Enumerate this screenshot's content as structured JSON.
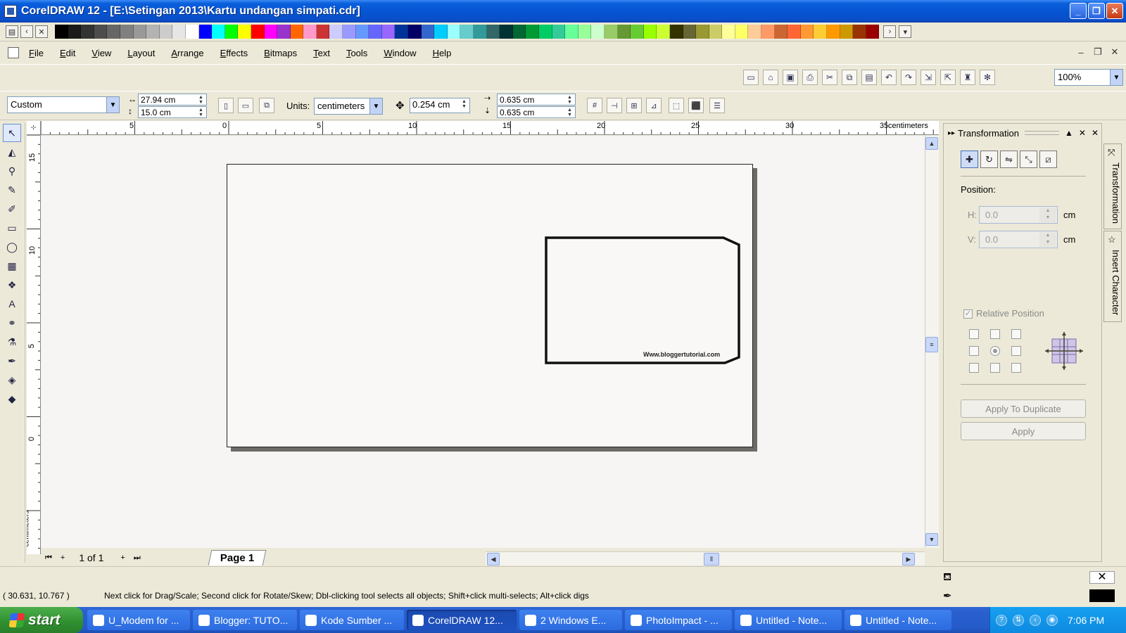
{
  "window": {
    "title": "CorelDRAW 12 - [E:\\Setingan 2013\\Kartu undangan simpati.cdr]"
  },
  "palette": {
    "colors": [
      "#000000",
      "#1a1a1a",
      "#333333",
      "#4d4d4d",
      "#666666",
      "#808080",
      "#999999",
      "#b3b3b3",
      "#cccccc",
      "#e6e6e6",
      "#ffffff",
      "#0000ff",
      "#00ffff",
      "#00ff00",
      "#ffff00",
      "#ff0000",
      "#ff00ff",
      "#9933cc",
      "#ff6600",
      "#ff99cc",
      "#cc3333",
      "#ccccff",
      "#9999ff",
      "#6699ff",
      "#6666ff",
      "#9966ff",
      "#003399",
      "#000066",
      "#3366cc",
      "#00ccff",
      "#99ffff",
      "#66cccc",
      "#339999",
      "#336666",
      "#003333",
      "#006633",
      "#009933",
      "#00cc66",
      "#33cc99",
      "#66ff99",
      "#99ff99",
      "#ccffcc",
      "#99cc66",
      "#669933",
      "#66cc33",
      "#99ff00",
      "#ccff33",
      "#333300",
      "#666633",
      "#999933",
      "#cccc66",
      "#ffff99",
      "#ffff66",
      "#ffcc99",
      "#ff9966",
      "#cc6633",
      "#ff6633",
      "#ff9933",
      "#ffcc33",
      "#ff9900",
      "#cc9900",
      "#993300",
      "#990000"
    ]
  },
  "menu": {
    "items": [
      {
        "first": "F",
        "rest": "ile"
      },
      {
        "first": "E",
        "rest": "dit"
      },
      {
        "first": "V",
        "rest": "iew"
      },
      {
        "first": "L",
        "rest": "ayout"
      },
      {
        "first": "A",
        "rest": "rrange"
      },
      {
        "first": "E",
        "rest": "ffects"
      },
      {
        "first": "B",
        "rest": "itmaps"
      },
      {
        "first": "T",
        "rest": "ext"
      },
      {
        "first": "T",
        "rest": "ools"
      },
      {
        "first": "W",
        "rest": "indow"
      },
      {
        "first": "H",
        "rest": "elp"
      }
    ]
  },
  "standard_toolbar": {
    "zoom": "100%"
  },
  "property_bar": {
    "paper_type": "Custom",
    "width": "27.94 cm",
    "height": "15.0 cm",
    "units_label": "Units:",
    "units_value": "centimeters",
    "nudge": "0.254 cm",
    "dup_x": "0.635 cm",
    "dup_y": "0.635 cm"
  },
  "ruler": {
    "h_labels": [
      "5",
      "0",
      "5",
      "10",
      "15",
      "20",
      "25",
      "30",
      "35"
    ],
    "h_unit": "centimeters",
    "v_labels": [
      "15",
      "10",
      "5",
      "0"
    ],
    "v_unit": "centimeters"
  },
  "canvas": {
    "card_url": "Www.bloggertutorial.com"
  },
  "page_nav": {
    "count": "1 of 1",
    "tab": "Page 1"
  },
  "docker": {
    "title": "Transformation",
    "position_label": "Position:",
    "h_label": "H:",
    "h_value": "0.0",
    "v_label": "V:",
    "v_value": "0.0",
    "unit": "cm",
    "relative_position": "Relative Position",
    "relative_checked": true,
    "apply_duplicate": "Apply To Duplicate",
    "apply": "Apply",
    "side_tabs": [
      "Transformation",
      "Insert Character"
    ]
  },
  "status": {
    "coords": "( 30.631, 10.767 )",
    "message": "Next click for Drag/Scale; Second click for Rotate/Skew; Dbl-clicking tool selects all objects; Shift+click multi-selects; Alt+click digs"
  },
  "taskbar": {
    "start": "start",
    "tasks": [
      {
        "label": "U_Modem for ...",
        "active": false
      },
      {
        "label": "Blogger: TUTO...",
        "active": false
      },
      {
        "label": "Kode Sumber ...",
        "active": false
      },
      {
        "label": "CorelDRAW 12...",
        "active": true
      },
      {
        "label": "2 Windows E...",
        "active": false
      },
      {
        "label": "PhotoImpact - ...",
        "active": false
      },
      {
        "label": "Untitled - Note...",
        "active": false
      },
      {
        "label": "Untitled - Note...",
        "active": false
      }
    ],
    "clock": "7:06 PM"
  }
}
